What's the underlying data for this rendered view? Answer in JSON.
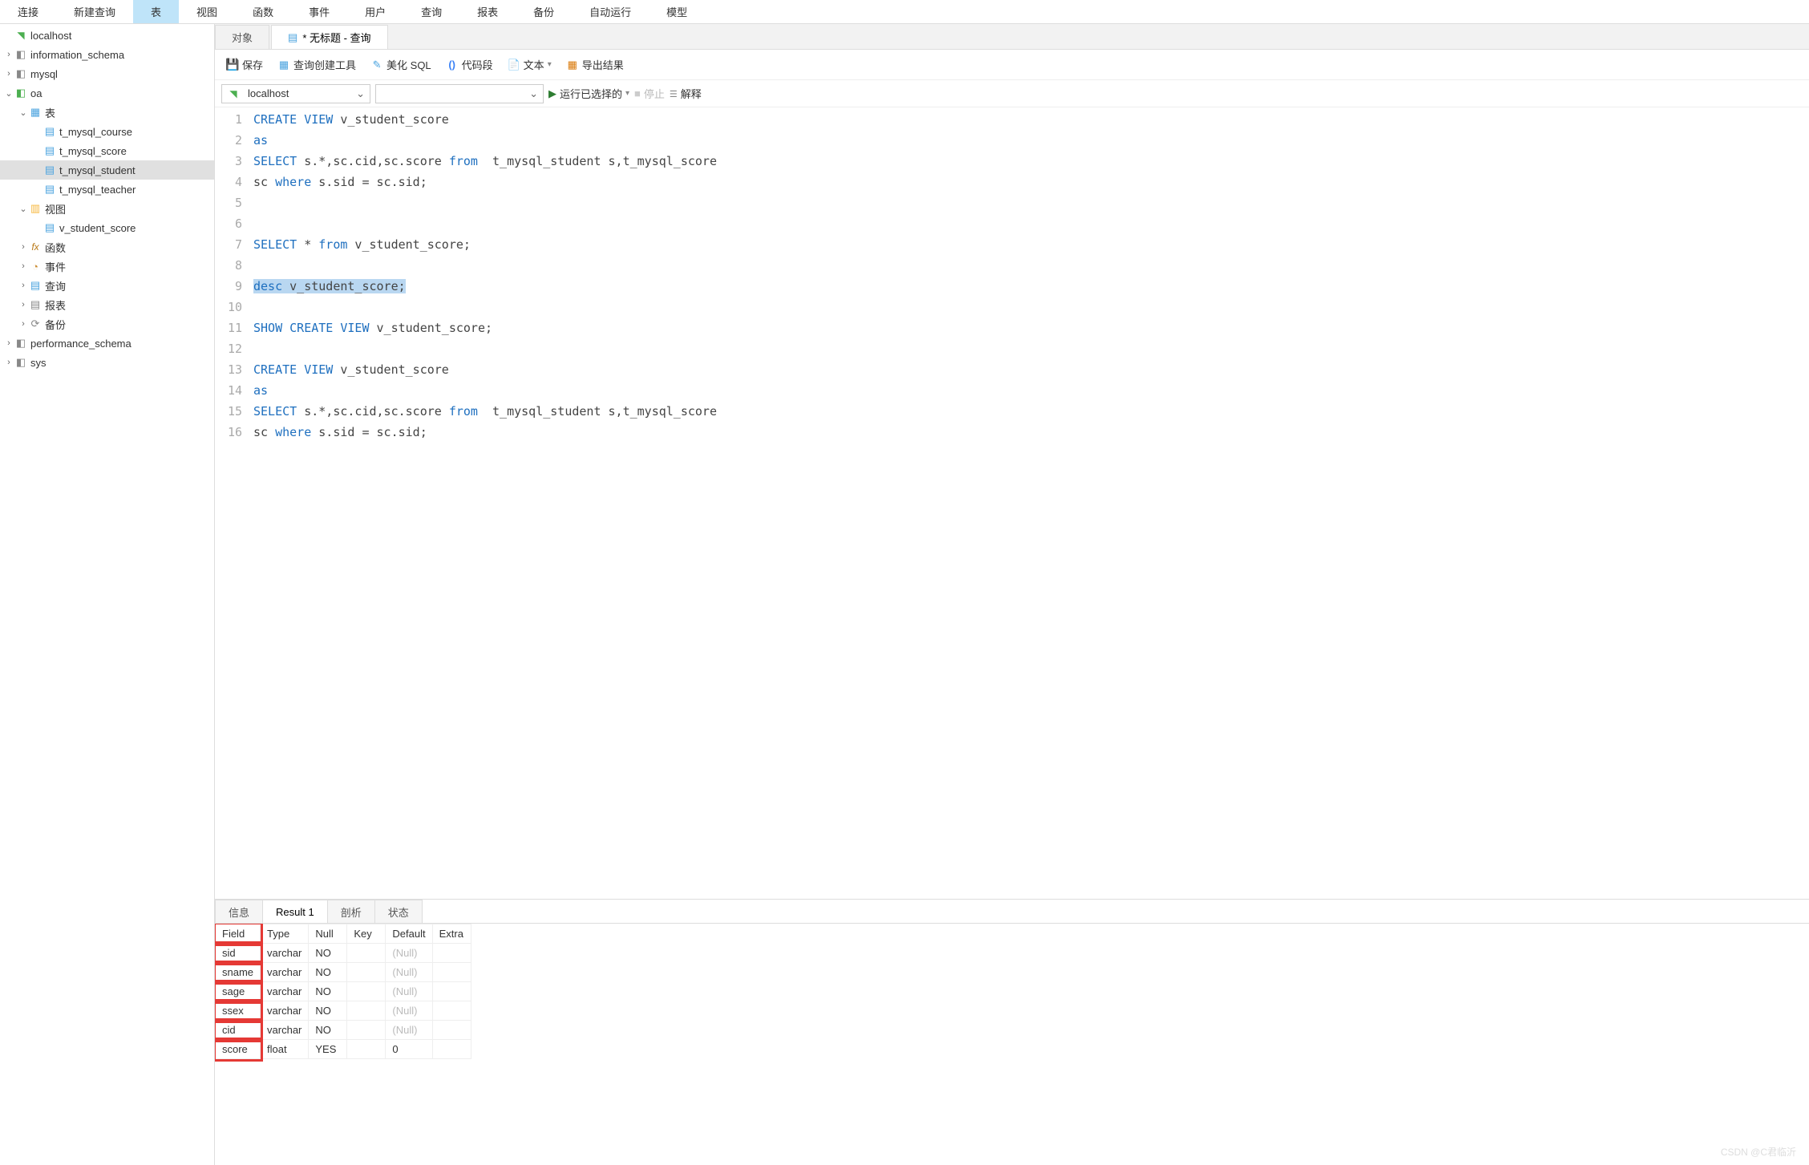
{
  "menubar": [
    "连接",
    "新建查询",
    "表",
    "视图",
    "函数",
    "事件",
    "用户",
    "查询",
    "报表",
    "备份",
    "自动运行",
    "模型"
  ],
  "menubar_active_index": 2,
  "sidebar": {
    "connection": "localhost",
    "databases": [
      {
        "name": "information_schema",
        "expanded": false
      },
      {
        "name": "mysql",
        "expanded": false
      },
      {
        "name": "oa",
        "expanded": true,
        "tables_label": "表",
        "tables": [
          "t_mysql_course",
          "t_mysql_score",
          "t_mysql_student",
          "t_mysql_teacher"
        ],
        "selected_table": "t_mysql_student",
        "views_label": "视图",
        "views": [
          "v_student_score"
        ],
        "fx_label": "函数",
        "events_label": "事件",
        "queries_label": "查询",
        "reports_label": "报表",
        "backup_label": "备份"
      },
      {
        "name": "performance_schema",
        "expanded": false
      },
      {
        "name": "sys",
        "expanded": false
      }
    ]
  },
  "tabs": [
    {
      "label": "对象",
      "active": false
    },
    {
      "label": "* 无标题 - 查询",
      "active": true
    }
  ],
  "toolbar": {
    "save": "保存",
    "builder": "查询创建工具",
    "beautify": "美化 SQL",
    "snippet": "代码段",
    "text": "文本",
    "export": "导出结果"
  },
  "conn_row": {
    "connection": "localhost",
    "database": "",
    "run": "运行已选择的",
    "stop": "停止",
    "explain": "解释"
  },
  "sql_lines": [
    [
      {
        "t": "CREATE",
        "c": "kw"
      },
      {
        "t": " "
      },
      {
        "t": "VIEW",
        "c": "kw"
      },
      {
        "t": " v_student_score"
      }
    ],
    [
      {
        "t": "as",
        "c": "kw"
      }
    ],
    [
      {
        "t": "SELECT",
        "c": "kw"
      },
      {
        "t": " s.*,sc.cid,sc.score "
      },
      {
        "t": "from",
        "c": "kw"
      },
      {
        "t": "  t_mysql_student s,t_mysql_score"
      }
    ],
    [
      {
        "t": "sc "
      },
      {
        "t": "where",
        "c": "kw"
      },
      {
        "t": " s.sid = sc.sid;"
      }
    ],
    [],
    [],
    [
      {
        "t": "SELECT",
        "c": "kw"
      },
      {
        "t": " * "
      },
      {
        "t": "from",
        "c": "kw"
      },
      {
        "t": " v_student_score;"
      }
    ],
    [],
    [
      {
        "t": "desc",
        "c": "kw hl"
      },
      {
        "t": " v_student_score;",
        "c": "hl"
      }
    ],
    [],
    [
      {
        "t": "SHOW",
        "c": "kw"
      },
      {
        "t": " "
      },
      {
        "t": "CREATE",
        "c": "kw"
      },
      {
        "t": " "
      },
      {
        "t": "VIEW",
        "c": "kw"
      },
      {
        "t": " v_student_score;"
      }
    ],
    [],
    [
      {
        "t": "CREATE",
        "c": "kw"
      },
      {
        "t": " "
      },
      {
        "t": "VIEW",
        "c": "kw"
      },
      {
        "t": " v_student_score"
      }
    ],
    [
      {
        "t": "as",
        "c": "kw"
      }
    ],
    [
      {
        "t": "SELECT",
        "c": "kw"
      },
      {
        "t": " s.*,sc.cid,sc.score "
      },
      {
        "t": "from",
        "c": "kw"
      },
      {
        "t": "  t_mysql_student s,t_mysql_score"
      }
    ],
    [
      {
        "t": "sc "
      },
      {
        "t": "where",
        "c": "kw"
      },
      {
        "t": " s.sid = sc.sid;"
      }
    ]
  ],
  "bottom_tabs": [
    "信息",
    "Result 1",
    "剖析",
    "状态"
  ],
  "bottom_active": 1,
  "result": {
    "columns": [
      "Field",
      "Type",
      "Null",
      "Key",
      "Default",
      "Extra"
    ],
    "rows": [
      [
        "sid",
        "varchar",
        "NO",
        "",
        "(Null)",
        ""
      ],
      [
        "sname",
        "varchar",
        "NO",
        "",
        "(Null)",
        ""
      ],
      [
        "sage",
        "varchar",
        "NO",
        "",
        "(Null)",
        ""
      ],
      [
        "ssex",
        "varchar",
        "NO",
        "",
        "(Null)",
        ""
      ],
      [
        "cid",
        "varchar",
        "NO",
        "",
        "(Null)",
        ""
      ],
      [
        "score",
        "float",
        "YES",
        "",
        "0",
        ""
      ]
    ]
  },
  "watermark": "CSDN @C君临沂"
}
